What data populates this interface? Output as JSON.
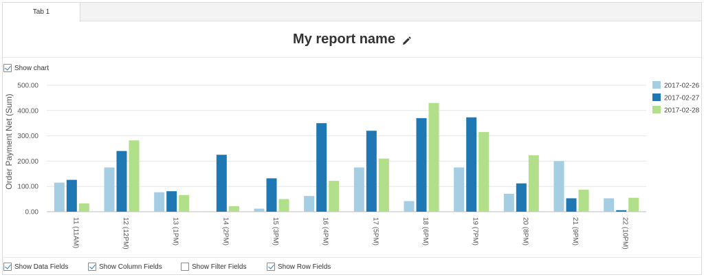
{
  "tabs": [
    {
      "label": "Tab 1"
    }
  ],
  "report": {
    "title": "My report name"
  },
  "show_chart": {
    "label": "Show chart",
    "checked": true
  },
  "fields": [
    {
      "label": "Show Data Fields",
      "checked": true
    },
    {
      "label": "Show Column Fields",
      "checked": true
    },
    {
      "label": "Show Filter Fields",
      "checked": false
    },
    {
      "label": "Show Row Fields",
      "checked": true
    }
  ],
  "chart_data": {
    "type": "bar",
    "ylabel": "Order Payment Net (Sum)",
    "ylim": [
      0,
      500
    ],
    "yticks": [
      "0.00",
      "100.00",
      "200.00",
      "300.00",
      "400.00",
      "500.00"
    ],
    "categories": [
      "11 (11AM)",
      "12 (12PM)",
      "13 (1PM)",
      "14 (2PM)",
      "15 (3PM)",
      "16 (4PM)",
      "17 (5PM)",
      "18 (6PM)",
      "19 (7PM)",
      "20 (8PM)",
      "21 (9PM)",
      "22 (10PM)"
    ],
    "series": [
      {
        "name": "2017-02-26",
        "color": "#a6cee3",
        "values": [
          115,
          175,
          77,
          0,
          12,
          62,
          175,
          42,
          175,
          71,
          200,
          53
        ]
      },
      {
        "name": "2017-02-27",
        "color": "#1f78b4",
        "values": [
          126,
          240,
          81,
          225,
          132,
          350,
          320,
          370,
          373,
          112,
          53,
          6
        ]
      },
      {
        "name": "2017-02-28",
        "color": "#b2df8a",
        "values": [
          33,
          282,
          66,
          22,
          50,
          122,
          210,
          430,
          315,
          223,
          87,
          55
        ]
      }
    ],
    "legend": "right",
    "grid": true
  }
}
